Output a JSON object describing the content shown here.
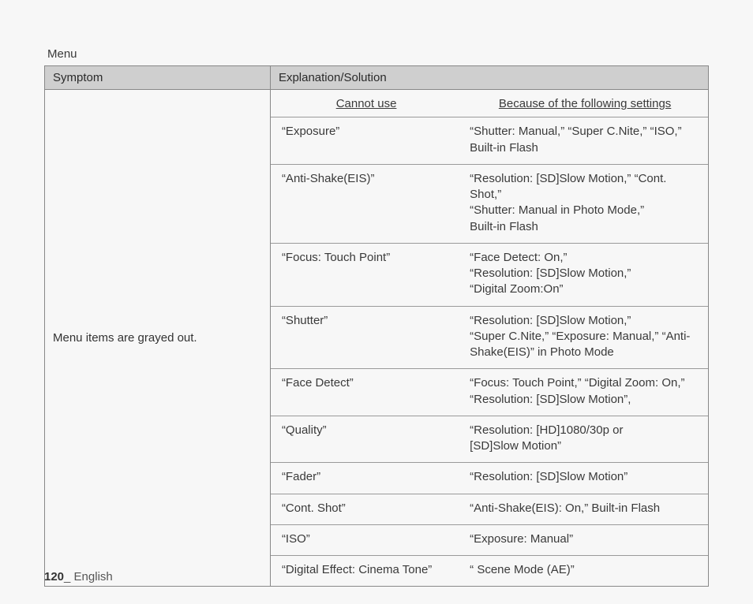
{
  "section": "Menu",
  "columns": {
    "symptom": "Symptom",
    "explanation": "Explanation/Solution"
  },
  "symptom": "Menu items are grayed out.",
  "subhead": {
    "cannot_use": "Cannot use",
    "because": "Because of the following settings"
  },
  "rows": [
    {
      "item": "“Exposure”",
      "reason": "“Shutter: Manual,” “Super C.Nite,” “ISO,” Built-in Flash"
    },
    {
      "item": "“Anti-Shake(EIS)”",
      "reason": "“Resolution: [SD]Slow Motion,” “Cont. Shot,”\n“Shutter: Manual in Photo Mode,”\n  Built-in Flash"
    },
    {
      "item": "“Focus: Touch Point”",
      "reason": "“Face Detect: On,”\n“Resolution: [SD]Slow Motion,”\n“Digital Zoom:On”"
    },
    {
      "item": "“Shutter”",
      "reason": "“Resolution: [SD]Slow Motion,”\n“Super C.Nite,” “Exposure: Manual,” “Anti-Shake(EIS)” in Photo Mode"
    },
    {
      "item": "“Face Detect”",
      "reason": "“Focus: Touch Point,” “Digital Zoom: On,” “Resolution: [SD]Slow Motion”,"
    },
    {
      "item": "“Quality”",
      "reason": "“Resolution: [HD]1080/30p or\n  [SD]Slow Motion”"
    },
    {
      "item": "“Fader”",
      "reason": "“Resolution: [SD]Slow Motion”"
    },
    {
      "item": "“Cont. Shot”",
      "reason": "“Anti-Shake(EIS): On,” Built-in Flash"
    },
    {
      "item": "“ISO”",
      "reason": "“Exposure: Manual”"
    },
    {
      "item": "“Digital Effect: Cinema Tone”",
      "reason": "“ Scene Mode (AE)”"
    }
  ],
  "footer": {
    "page": "120",
    "sep": "_ ",
    "lang": "English"
  }
}
